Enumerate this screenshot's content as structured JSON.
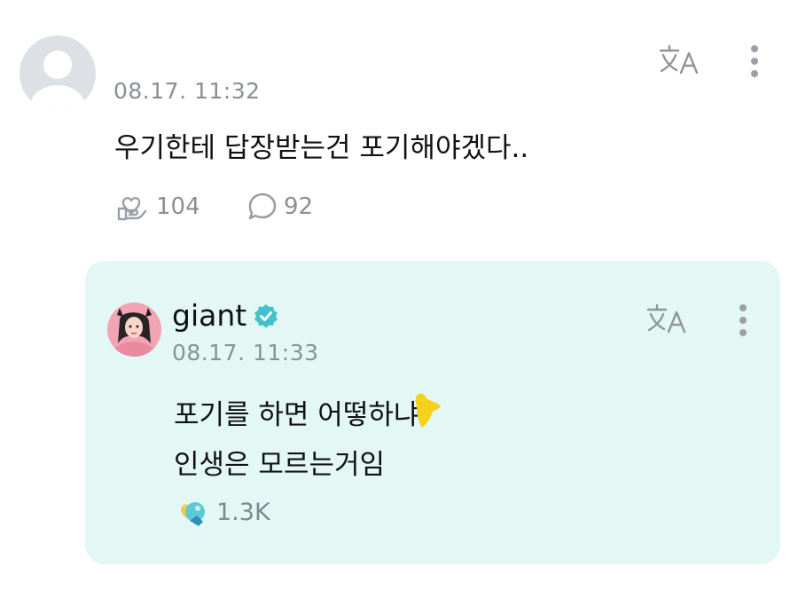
{
  "comment": {
    "timestamp": "08.17. 11:32",
    "text": "우기한테 답장받는건 포기해야겠다..",
    "likes": "104",
    "replies": "92"
  },
  "artist_reply": {
    "name": "giant",
    "timestamp": "08.17. 11:33",
    "text_lines": [
      "포기를 하면 어떻하냐",
      "인생은 모르는거임"
    ],
    "likes": "1.3K"
  },
  "colors": {
    "reply_background": "#e3f8f5",
    "accent": "#3fc2c9",
    "muted_text": "#8a8f95"
  },
  "icons": {
    "translate": "translate-icon",
    "more": "more-vertical-icon",
    "like": "heart-hand-icon",
    "reply": "comment-bubble-icon",
    "verified": "verified-badge-icon"
  }
}
